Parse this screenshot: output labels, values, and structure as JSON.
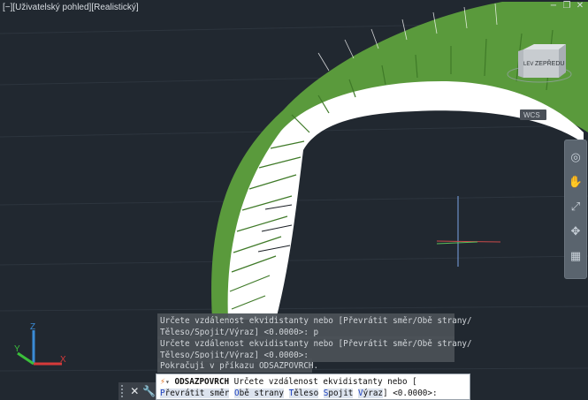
{
  "viewport": {
    "label_parts": [
      "[−]",
      "[Uživatelský pohled]",
      "[Realistický]"
    ],
    "window_controls": [
      "−",
      "❐",
      "✕"
    ],
    "viewcube_face": "ZEPŘEDU",
    "viewcube_side": "LEV",
    "wcs_label": "WCS",
    "ucs_icon": {
      "x_label": "X",
      "y_label": "Y",
      "z_label": "Z"
    }
  },
  "colors": {
    "background": "#212830",
    "surface_green": "#5a9a3c",
    "surface_white": "#ffffff",
    "ucs_x": "#d63a3a",
    "ucs_y": "#3bbf3b",
    "ucs_z": "#3a8bd6"
  },
  "navbar": {
    "buttons": [
      "steering-wheel-icon",
      "pan-hand-icon",
      "zoom-icon",
      "orbit-icon",
      "showmotion-icon"
    ]
  },
  "command_history": [
    {
      "line1": "Určete vzdálenost ekvidistanty nebo [Převrátit směr/Obě strany/",
      "line2": "Těleso/Spojit/Výraz] <0.0000>: p"
    },
    {
      "line1": "Určete vzdálenost ekvidistanty nebo [Převrátit směr/Obě strany/",
      "line2": "Těleso/Spojit/Výraz] <0.0000>:"
    },
    {
      "line1": "Pokračuji v příkazu ODSAZPOVRCH."
    }
  ],
  "command_line": {
    "close_glyph": "✕",
    "settings_glyph": "🔧",
    "dropdown_glyph": "▾",
    "command_name": "ODSAZPOVRCH",
    "prompt": "Určete vzdálenost ekvidistanty nebo [",
    "options": [
      {
        "key": "P",
        "rest": "řevrátit směr"
      },
      {
        "key": "O",
        "rest": "bě strany"
      },
      {
        "key": "T",
        "rest": "ěleso"
      },
      {
        "key": "S",
        "rest": "pojit"
      },
      {
        "key": "V",
        "rest": "ýraz"
      }
    ],
    "suffix": "] <0.0000>:"
  }
}
